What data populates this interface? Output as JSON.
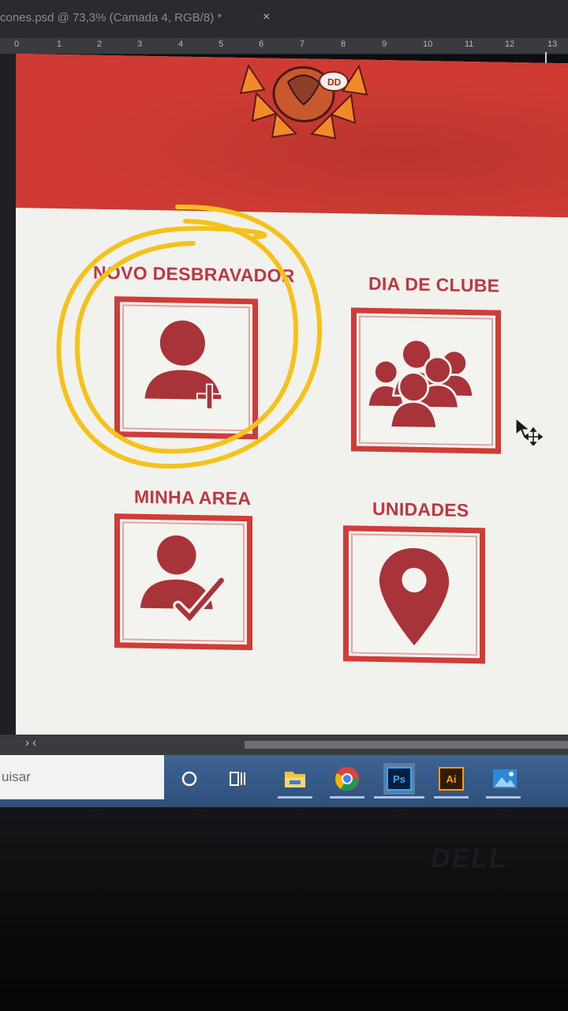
{
  "window": {
    "doc_title": "cones.psd @ 73,3% (Camada 4, RGB/8) *",
    "close_glyph": "×"
  },
  "ruler": {
    "ticks": [
      "0",
      "1",
      "2",
      "3",
      "4",
      "5",
      "6",
      "7",
      "8",
      "9",
      "10",
      "11",
      "12",
      "13"
    ]
  },
  "app": {
    "tiles": [
      {
        "label": "NOVO DESBRAVADOR",
        "icon": "add-user-icon"
      },
      {
        "label": "DIA DE CLUBE",
        "icon": "group-icon"
      },
      {
        "label": "MINHA AREA",
        "icon": "user-check-icon"
      },
      {
        "label": "UNIDADES",
        "icon": "location-pin-icon"
      }
    ],
    "colors": {
      "header": "#cf3b33",
      "accent": "#cf3d39",
      "label": "#bd3741",
      "icon": "#a8343a",
      "highlight": "#f5c21b"
    }
  },
  "statusbar": {
    "scroll_left": "›  ‹"
  },
  "taskbar": {
    "search_placeholder": "uisar",
    "apps": [
      "cortana-icon",
      "task-view-icon",
      "file-explorer-icon",
      "chrome-icon",
      "photoshop-icon",
      "illustrator-icon",
      "photos-icon"
    ],
    "ps_label": "Ps",
    "ai_label": "Ai"
  },
  "device": {
    "brand": "DELL"
  }
}
